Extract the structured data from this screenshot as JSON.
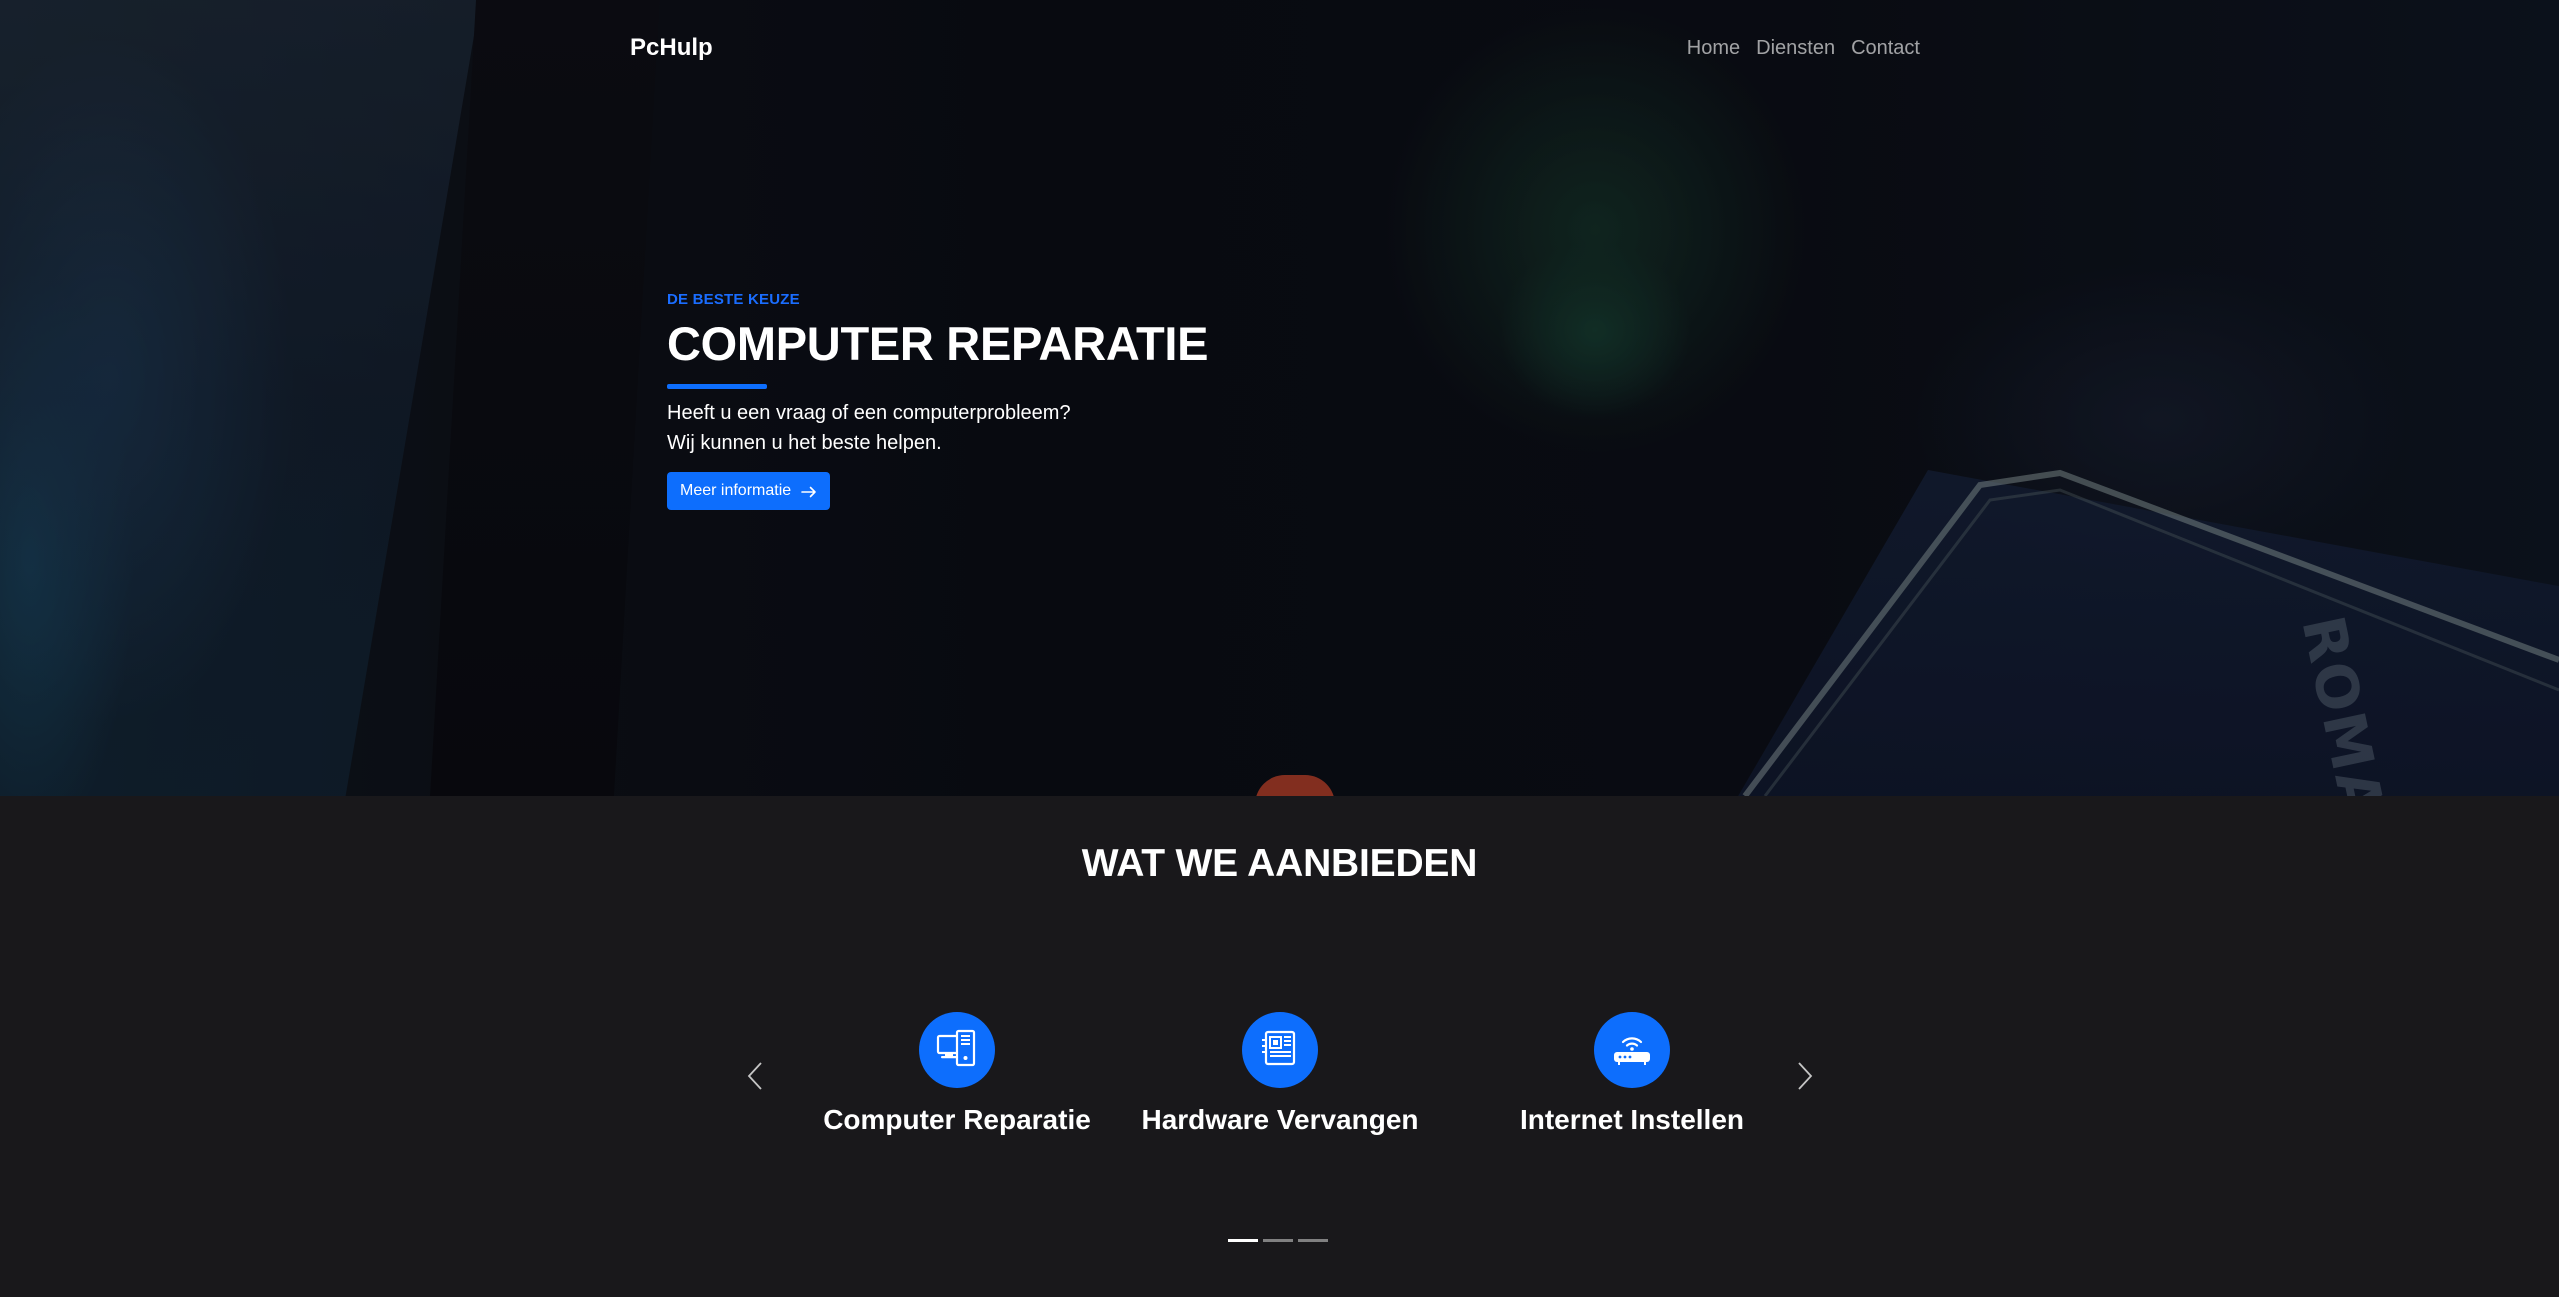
{
  "navbar": {
    "brand": "PcHulp",
    "links": [
      "Home",
      "Diensten",
      "Contact"
    ]
  },
  "hero": {
    "eyebrow": "DE BESTE KEUZE",
    "title": "COMPUTER REPARATIE",
    "text_lines": [
      "Heeft u een vraag of een computerprobleem?",
      "Wij kunnen u het beste helpen."
    ],
    "button_label": "Meer informatie",
    "button_icon": "arrow-right-icon",
    "background_deco_text": "ROMA SYS LIMITED"
  },
  "services": {
    "title": "WAT WE AANBIEDEN",
    "items": [
      {
        "label": "Computer Reparatie",
        "icon": "computer-icon"
      },
      {
        "label": "Hardware Vervangen",
        "icon": "motherboard-icon"
      },
      {
        "label": "Internet Instellen",
        "icon": "router-icon"
      }
    ],
    "prev_icon": "chevron-left-icon",
    "next_icon": "chevron-right-icon",
    "indicators": 3,
    "active_indicator": 0
  },
  "colors": {
    "accent": "#0d6efd",
    "page_background": "#19181b",
    "text": "#ffffff"
  }
}
